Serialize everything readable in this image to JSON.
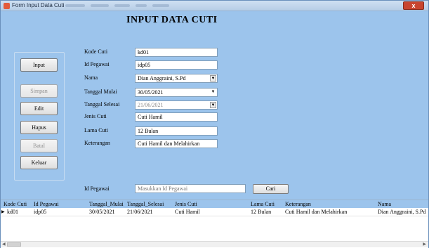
{
  "window": {
    "title": "Form Input Data Cuti",
    "close_label": "x"
  },
  "heading": "INPUT DATA CUTI",
  "buttons": {
    "input": "Input",
    "simpan": "Simpan",
    "edit": "Edit",
    "hapus": "Hapus",
    "batal": "Batal",
    "keluar": "Keluar"
  },
  "form": {
    "kode_cuti": {
      "label": "Kode Cuti",
      "value": "kd01"
    },
    "id_pegawai": {
      "label": "Id Pegawai",
      "value": "idp05"
    },
    "nama": {
      "label": "Nama",
      "value": "Dian Anggraini, S.Pd"
    },
    "tanggal_mulai": {
      "label": "Tanggal Mulai",
      "value": "30/05/2021"
    },
    "tanggal_selesai": {
      "label": "Tanggal Selesai",
      "value": "21/06/2021"
    },
    "jenis_cuti": {
      "label": "Jenis Cuti",
      "value": "Cuti Hamil"
    },
    "lama_cuti": {
      "label": "Lama Cuti",
      "value": "12 Bulan"
    },
    "keterangan": {
      "label": "Keterangan",
      "value": "Cuti Hamil dan Melahirkan"
    }
  },
  "search": {
    "label": "Id Pegawai",
    "placeholder": "Masukkan Id Pegawai",
    "button": "Cari"
  },
  "table": {
    "columns": [
      "Kode Cuti",
      "Id Pegawai",
      "Tanggal_Mulai",
      "Tanggal_Selesai",
      "Jenis Cuti",
      "Lama Cuti",
      "Keterangan",
      "Nama"
    ],
    "rows": [
      [
        "kd01",
        "idp05",
        "30/05/2021",
        "21/06/2021",
        "Cuti Hamil",
        "12 Bulan",
        "Cuti Hamil dan Melahirkan",
        "Dian Anggraini, S.Pd"
      ]
    ]
  },
  "icons": {
    "app": "form-app-icon",
    "dropdown": "chevron-down-icon",
    "row_marker": "row-pointer-icon"
  },
  "colors": {
    "window_bg": "#9cc4ec",
    "close_button": "#c8452f"
  }
}
